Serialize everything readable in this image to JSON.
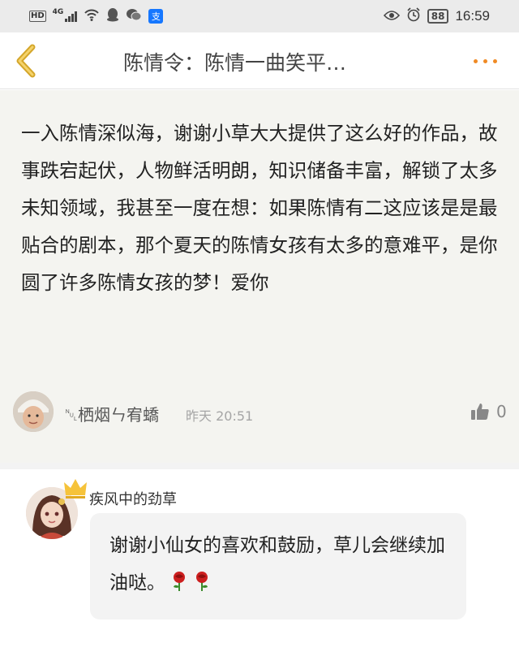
{
  "status_bar": {
    "network_badge": "HD",
    "network_type": "4G",
    "alipay_glyph": "支",
    "battery": "88",
    "time": "16:59",
    "icons": [
      "hd-icon",
      "signal-icon",
      "wifi-icon",
      "qq-icon",
      "wechat-icon",
      "alipay-icon",
      "eye-icon",
      "alarm-icon",
      "battery-icon"
    ]
  },
  "nav": {
    "title": "陈情令：陈情一曲笑平…",
    "back_icon": "chevron-left-icon",
    "more_icon": "more-dots-icon",
    "accent_color": "#f08a24"
  },
  "comment": {
    "text": "一入陈情深似海，谢谢小草大大提供了这么好的作品，故事跌宕起伏，人物鲜活明朗，知识储备丰富，解锁了太多未知领域，我甚至一度在想：如果陈情有二这应该是是最贴合的剧本，那个夏天的陈情女孩有太多的意难平，是你圆了许多陈情女孩的梦！爱你",
    "author": "␀栖烟ㄣ宥蟜",
    "time": "昨天 20:51",
    "likes": "0",
    "like_icon": "thumbs-up-icon"
  },
  "reply": {
    "author": "疾风中的劲草",
    "text": "谢谢小仙女的喜欢和鼓励，草儿会继续加油哒。",
    "badge_icon": "crown-icon",
    "emoji_icons": [
      "rose-icon",
      "rose-icon"
    ]
  }
}
